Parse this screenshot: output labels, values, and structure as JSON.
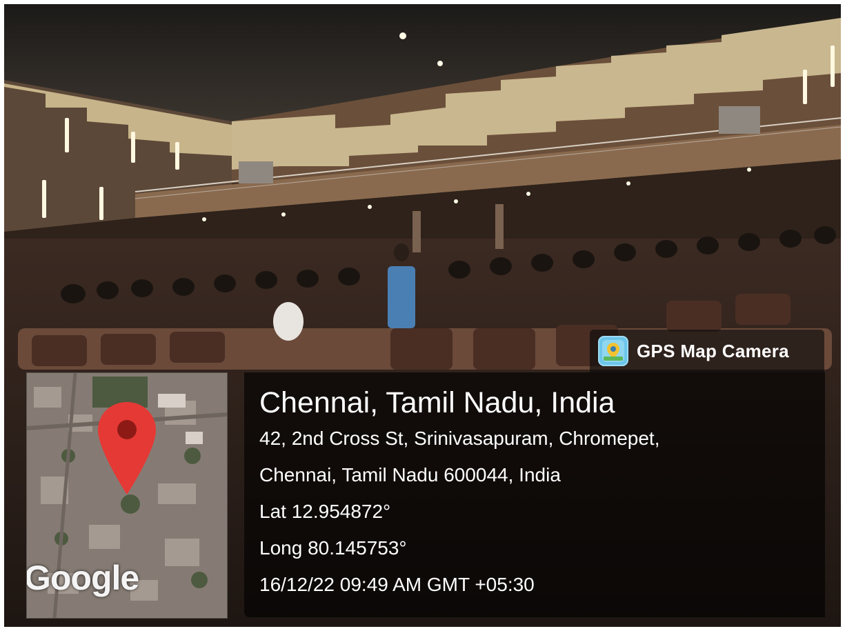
{
  "watermark": {
    "app_name": "GPS Map Camera",
    "location_title": "Chennai, Tamil Nadu, India",
    "address_line1": "42, 2nd Cross St, Srinivasapuram, Chromepet,",
    "address_line2": "Chennai, Tamil Nadu 600044, India",
    "latitude": "Lat 12.954872°",
    "longitude": "Long 80.145753°",
    "datetime": "16/12/22 09:49 AM GMT +05:30"
  },
  "map": {
    "attribution": "Google",
    "pin_color": "#e53935"
  },
  "colors": {
    "overlay": "#000000",
    "app_icon": "#6dc6ea"
  }
}
